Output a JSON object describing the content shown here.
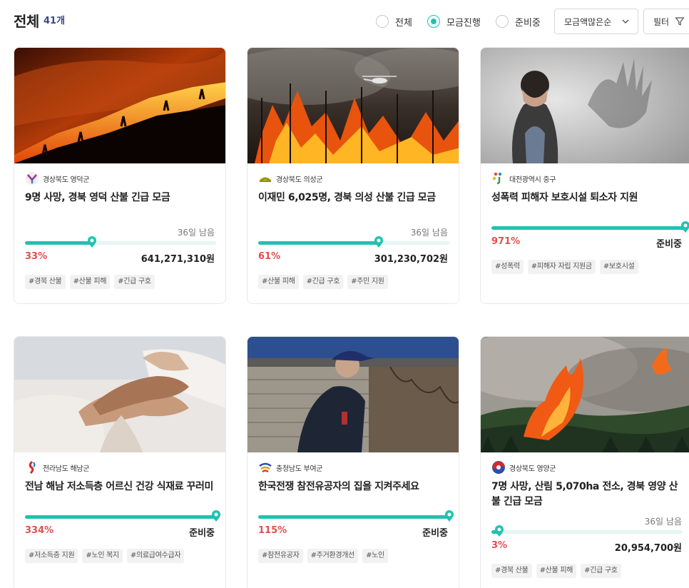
{
  "header": {
    "title": "전체",
    "count": "41개",
    "filters": [
      {
        "label": "전체",
        "checked": false
      },
      {
        "label": "모금진행",
        "checked": true
      },
      {
        "label": "준비중",
        "checked": false
      }
    ],
    "sort": {
      "selected": "모금액많은순"
    },
    "filter_button": "필터"
  },
  "colors": {
    "accent": "#1fc3b0",
    "percent": "#e14f4f"
  },
  "cards": [
    {
      "org": "경상북도 영덕군",
      "title": "9명 사망, 경북 영덕 산불 긴급 모금",
      "days": "36일 남음",
      "progress": 0.33,
      "percent": "33%",
      "amount": "641,271,310원",
      "tags": [
        "#경북 산불",
        "#산불 피해",
        "#긴급 구호"
      ]
    },
    {
      "org": "경상북도 의성군",
      "title": "이재민 6,025명, 경북 의성 산불 긴급 모금",
      "days": "36일 남음",
      "progress": 0.61,
      "percent": "61%",
      "amount": "301,230,702원",
      "tags": [
        "#산불 피해",
        "#긴급 구호",
        "#주민 지원"
      ]
    },
    {
      "org": "대전광역시 중구",
      "title": "성폭력 피해자 보호시설 퇴소자 지원",
      "days": "",
      "progress": 1.0,
      "percent": "971%",
      "amount": "준비중",
      "tags": [
        "#성폭력",
        "#피해자 자립 지원금",
        "#보호시설"
      ]
    },
    {
      "org": "전라남도 해남군",
      "title": "전남 해남 저소득층 어르신 건강 식재료 꾸러미",
      "days": "",
      "progress": 1.0,
      "percent": "334%",
      "amount": "준비중",
      "tags": [
        "#저소득층 지원",
        "#노인 복지",
        "#의료급여수급자"
      ]
    },
    {
      "org": "충청남도 부여군",
      "title": "한국전쟁 참전유공자의 집을 지켜주세요",
      "days": "",
      "progress": 1.0,
      "percent": "115%",
      "amount": "준비중",
      "tags": [
        "#참전유공자",
        "#주거환경개선",
        "#노인"
      ]
    },
    {
      "org": "경상북도 영양군",
      "title": "7명 사망, 산림 5,070ha 전소, 경북 영양 산불 긴급 모금",
      "days": "36일 남음",
      "progress": 0.03,
      "percent": "3%",
      "amount": "20,954,700원",
      "tags": [
        "#경북 산불",
        "#산불 피해",
        "#긴급 구호"
      ]
    }
  ]
}
